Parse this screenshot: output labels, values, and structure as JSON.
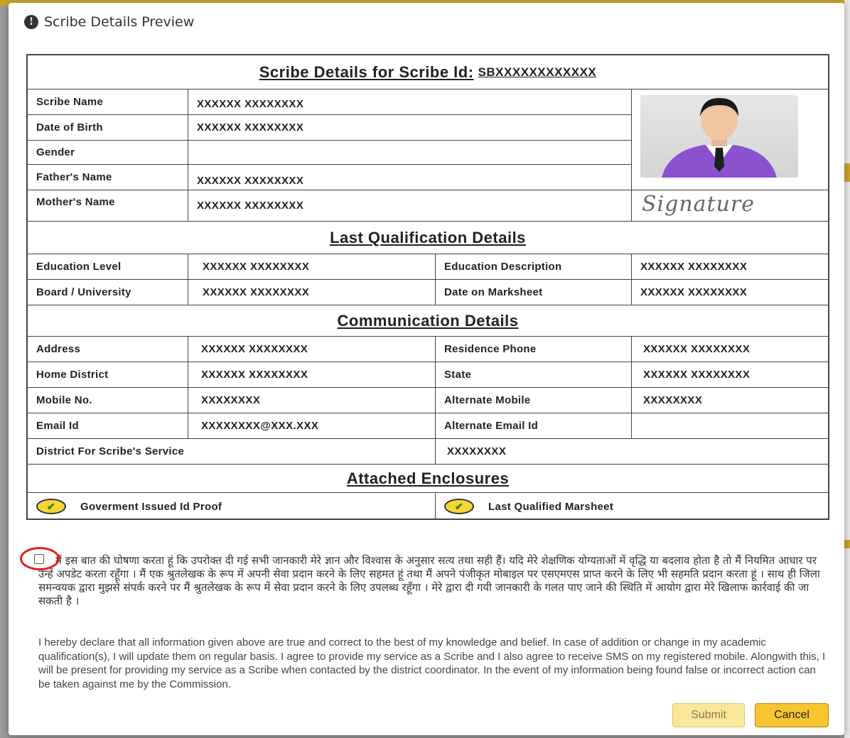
{
  "modal": {
    "title": "Scribe Details Preview",
    "info_icon": "info-circle-icon"
  },
  "scribe": {
    "header_label": "Scribe Details for Scribe Id:",
    "id": "SBXXXXXXXXXXXX",
    "fields": [
      {
        "label": "Scribe Name",
        "value": "XXXXXX XXXXXXXX"
      },
      {
        "label": "Date of Birth",
        "value": "XXXXXX XXXXXXXX"
      },
      {
        "label": "Gender",
        "value": ""
      },
      {
        "label": "Father's Name",
        "value": "XXXXXX XXXXXXXX"
      },
      {
        "label": "Mother's Name",
        "value": "XXXXXX XXXXXXXX"
      }
    ],
    "photo": "person-avatar-icon",
    "signature": "Signature"
  },
  "qualification": {
    "title": "Last Qualification Details",
    "rows": [
      {
        "l1": "Education Level",
        "v1": "XXXXXX XXXXXXXX",
        "l2": "Education Description",
        "v2": "XXXXXX XXXXXXXX"
      },
      {
        "l1": "Board / University",
        "v1": "XXXXXX XXXXXXXX",
        "l2": "Date on Marksheet",
        "v2": "XXXXXX XXXXXXXX"
      }
    ]
  },
  "communication": {
    "title": "Communication Details",
    "rows": [
      {
        "l1": "Address",
        "v1": "XXXXXX XXXXXXXX",
        "l2": "Residence Phone",
        "v2": "XXXXXX XXXXXXXX"
      },
      {
        "l1": "Home District",
        "v1": "XXXXXX XXXXXXXX",
        "l2": "State",
        "v2": "XXXXXX XXXXXXXX"
      },
      {
        "l1": "Mobile No.",
        "v1": "XXXXXXXX",
        "l2": "Alternate Mobile",
        "v2": "XXXXXXXX"
      },
      {
        "l1": "Email Id",
        "v1": "XXXXXXXX@XXX.XXX",
        "l2": "Alternate Email Id",
        "v2": ""
      }
    ],
    "district_label": "District For Scribe's Service",
    "district_value": "XXXXXXXX"
  },
  "enclosures": {
    "title": "Attached Enclosures",
    "items": [
      "Goverment Issued Id Proof",
      "Last Qualified Marsheet"
    ]
  },
  "declaration": {
    "hindi": "मैं इस बात की घोषणा करता हूं कि उपरोक्त दी गई सभी जानकारी मेरे ज्ञान और विश्वास के अनुसार सत्य तथा सही हैं। यदि मेरे शेक्षणिक योग्यताओं में वृद्धि या बदलाव होता है तो मैं नियमित आधार पर उन्हें अपडेट करता रहूँगा । मैं एक श्रुतलेखक के रूप में अपनी सेवा प्रदान करने के लिए सहमत हूं तथा मैं अपने पंजीकृत मोबाइल पर एसएमएस प्राप्त करने के लिए भी सहमति प्रदान करता हूं । साथ ही जिला समन्वयक द्वारा मुझसे संपर्क करने पर मैं श्रुतलेखक के रूप में सेवा प्रदान करने के लिए उपलब्ध रहूँगा । मेरे द्वारा दी गयी जानकारी के गलत पाए जाने की स्थिति में आयोग द्वारा मेरे खिलाफ कार्रवाई की जा सकती है ।",
    "english": "I hereby declare that all information given above are true and correct to the best of my knowledge and belief. In case of addition or change in my academic qualification(s), I will update them on regular basis. I agree to provide my service as a Scribe and I also agree to receive SMS on my registered mobile. Alongwith this, I will be present for providing my service as a Scribe when contacted by the district coordinator. In the event of my information being found false or incorrect action can be taken against me by the Commission."
  },
  "buttons": {
    "submit": "Submit",
    "cancel": "Cancel"
  }
}
